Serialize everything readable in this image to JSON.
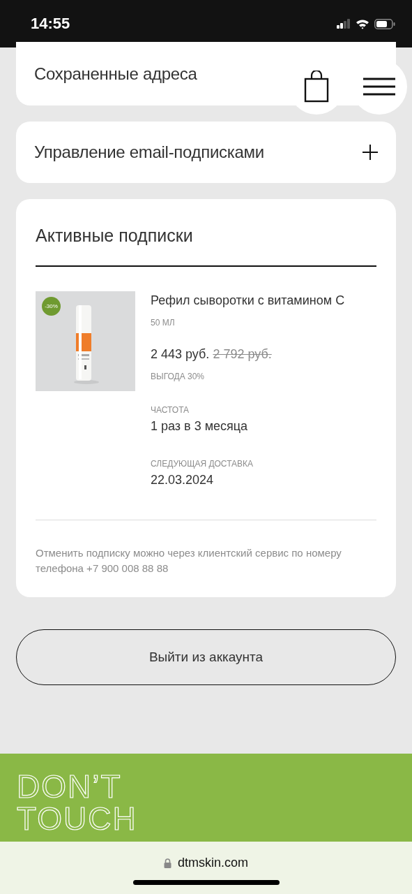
{
  "status_bar": {
    "time": "14:55"
  },
  "sections": [
    {
      "title": "Сохраненные адреса"
    },
    {
      "title": "Управление email-подписками",
      "expandable": true
    }
  ],
  "header_buttons": [
    {
      "kind": "bag"
    },
    {
      "kind": "menu"
    }
  ],
  "subscriptions": {
    "title": "Активные подписки",
    "items": [
      {
        "image": {
          "kind": "picture",
          "badge": "-30%"
        },
        "name": "Рефил сыворотки с витамином С",
        "volume": "50 МЛ",
        "price": "2 443 руб.",
        "old_price": "2 792 руб.",
        "saving": "ВЫГОДА 30%",
        "frequency_label": "ЧАСТОТА",
        "frequency": "1 раз в 3 месяца",
        "delivery_label": "СЛЕДУЮЩАЯ ДОСТАВКА",
        "delivery": "22.03.2024"
      }
    ],
    "note": "Отменить подписку можно через клиентский сервис по номеру телефона +7 900 008 88 88"
  },
  "logout_button": "Выйти из аккаунта",
  "footer": {
    "logo_lines": [
      "DON’T",
      "TOUCH"
    ]
  },
  "browser": {
    "url": "dtmskin.com"
  }
}
